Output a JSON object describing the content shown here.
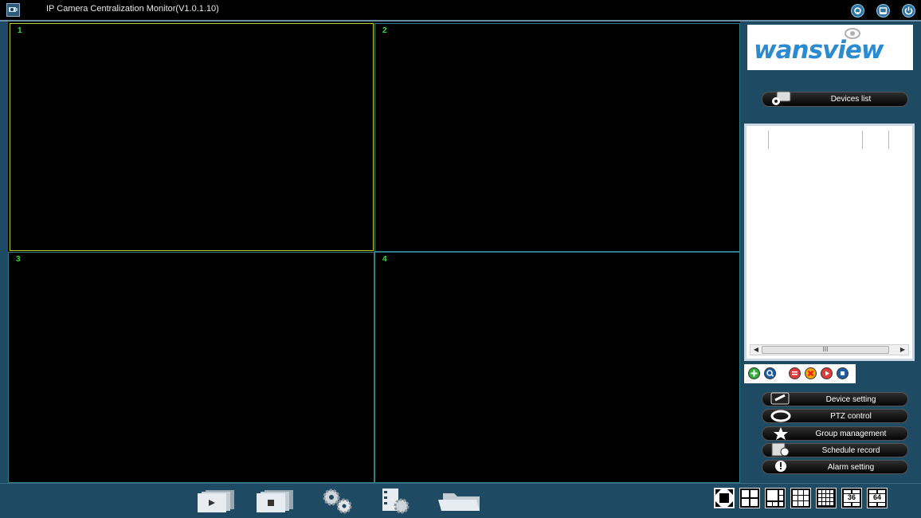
{
  "app": {
    "title": "IP Camera Centralization Monitor(V1.0.1.10)"
  },
  "window_buttons": [
    "settings-icon",
    "minimize-icon",
    "power-icon"
  ],
  "panes": [
    {
      "label": "1",
      "active": true
    },
    {
      "label": "2",
      "active": false
    },
    {
      "label": "3",
      "active": false
    },
    {
      "label": "4",
      "active": false
    }
  ],
  "logo": {
    "text": "wansview"
  },
  "devices_list": {
    "label": "Devices list"
  },
  "device_table": {
    "scroll_thumb": "III"
  },
  "device_actions": [
    "add-device-icon",
    "search-device-icon",
    "edit-device-icon",
    "delete-device-icon",
    "play-icon",
    "stop-icon"
  ],
  "menu": {
    "device_setting": "Device setting",
    "ptz_control": "PTZ control",
    "group_management": "Group management",
    "schedule_record": "Schedule record",
    "alarm_setting": "Alarm setting"
  },
  "toolbar": [
    "play-all-icon",
    "stop-all-icon",
    "settings-gears-icon",
    "record-icon",
    "folder-icon"
  ],
  "layouts": {
    "full": "fullscreen-icon",
    "l36": "36",
    "l64": "64"
  }
}
